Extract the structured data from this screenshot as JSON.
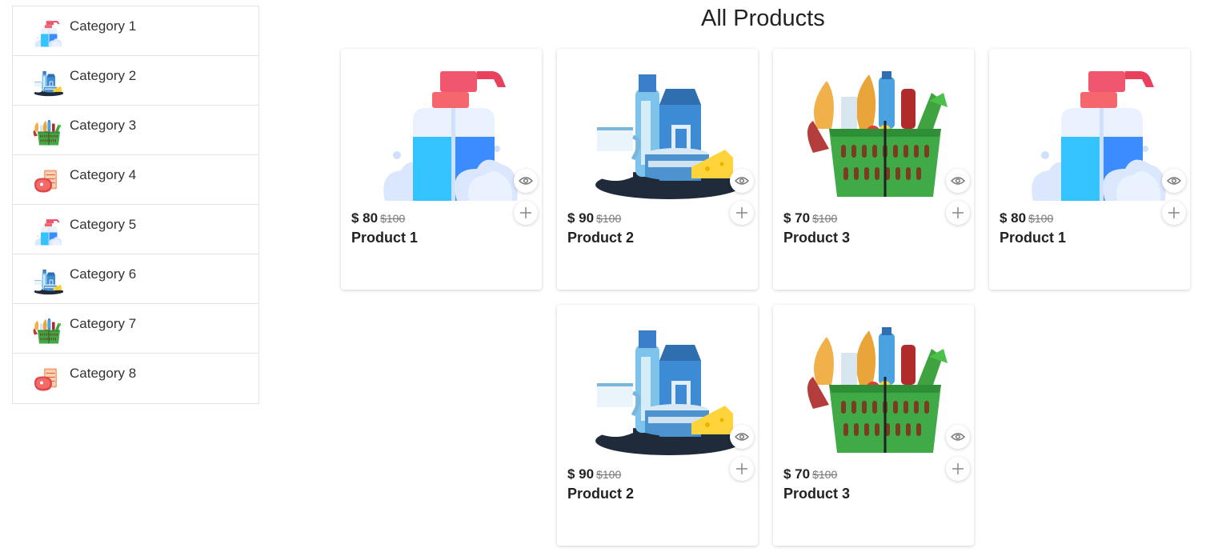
{
  "sidebar": {
    "categories": [
      {
        "label": "Category 1",
        "icon": "sanitizer-icon"
      },
      {
        "label": "Category 2",
        "icon": "dairy-icon"
      },
      {
        "label": "Category 3",
        "icon": "grocery-basket-icon"
      },
      {
        "label": "Category 4",
        "icon": "meat-icon"
      },
      {
        "label": "Category 5",
        "icon": "sanitizer-icon"
      },
      {
        "label": "Category 6",
        "icon": "dairy-icon"
      },
      {
        "label": "Category 7",
        "icon": "grocery-basket-icon"
      },
      {
        "label": "Category 8",
        "icon": "meat-icon"
      }
    ]
  },
  "main": {
    "title": "All Products",
    "products": [
      {
        "name": "Product 1",
        "price": "$ 80",
        "old_price": "$100",
        "image": "sanitizer-icon"
      },
      {
        "name": "Product 2",
        "price": "$ 90",
        "old_price": "$100",
        "image": "dairy-icon"
      },
      {
        "name": "Product 3",
        "price": "$ 70",
        "old_price": "$100",
        "image": "grocery-basket-icon"
      },
      {
        "name": "Product 1",
        "price": "$ 80",
        "old_price": "$100",
        "image": "sanitizer-icon"
      },
      {
        "name": "Product 2",
        "price": "$ 90",
        "old_price": "$100",
        "image": "dairy-icon"
      },
      {
        "name": "Product 3",
        "price": "$ 70",
        "old_price": "$100",
        "image": "grocery-basket-icon"
      }
    ],
    "icons": {
      "view": "eye-icon",
      "add": "plus-icon"
    }
  }
}
